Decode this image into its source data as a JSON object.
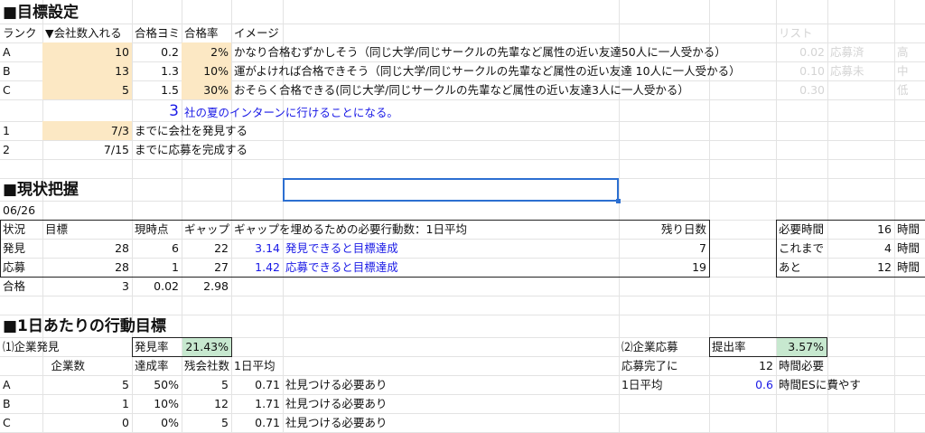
{
  "s1": {
    "title": "■目標設定",
    "headers": {
      "rank": "ランク",
      "companies": "▼会社数入れる",
      "pass_est": "合格ヨミ",
      "pass_rate": "合格率",
      "image": "イメージ",
      "list": "リスト"
    },
    "rows": [
      {
        "rank": "A",
        "companies": "10",
        "pass_est": "0.2",
        "pass_rate": "2%",
        "image": "かなり合格むずかしそう（同じ大学/同じサークルの先輩など属性の近い友達50人に一人受かる）",
        "list_val": "0.02",
        "list_status": "応募済",
        "list_level": "高"
      },
      {
        "rank": "B",
        "companies": "13",
        "pass_est": "1.3",
        "pass_rate": "10%",
        "image": "運がよければ合格できそう（同じ大学/同じサークルの先輩など属性の近い友達 10人に一人受かる）",
        "list_val": "0.10",
        "list_status": "応募未",
        "list_level": "中"
      },
      {
        "rank": "C",
        "companies": "5",
        "pass_est": "1.5",
        "pass_rate": "30%",
        "image": "おそらく合格できる(同じ大学/同じサークルの先輩など属性の近い友達3人に一人受かる）",
        "list_val": "0.30",
        "list_status": "",
        "list_level": "低"
      }
    ],
    "summary_num": "3",
    "summary_text": "社の夏のインターンに行けることになる。",
    "deadlines": [
      {
        "num": "1",
        "date": "7/3",
        "text": "までに会社を発見する"
      },
      {
        "num": "2",
        "date": "7/15",
        "text": "までに応募を完成する"
      }
    ]
  },
  "s2": {
    "title": "■現状把握",
    "date": "06/26",
    "headers": {
      "status": "状況",
      "target": "目標",
      "current": "現時点",
      "gap": "ギャップ",
      "action": "ギャップを埋めるための必要行動数：1日平均",
      "days_left": "残り日数"
    },
    "rows": [
      {
        "status": "発見",
        "target": "28",
        "current": "6",
        "gap": "22",
        "daily": "3.14",
        "note": "発見できると目標達成",
        "days": "7"
      },
      {
        "status": "応募",
        "target": "28",
        "current": "1",
        "gap": "27",
        "daily": "1.42",
        "note": "応募できると目標達成",
        "days": "19"
      },
      {
        "status": "合格",
        "target": "3",
        "current": "0.02",
        "gap": "2.98",
        "daily": "",
        "note": "",
        "days": ""
      }
    ],
    "time_box": [
      {
        "label": "必要時間",
        "value": "16",
        "unit": "時間"
      },
      {
        "label": "これまで",
        "value": "4",
        "unit": "時間"
      },
      {
        "label": "あと",
        "value": "12",
        "unit": "時間"
      }
    ]
  },
  "s3": {
    "title": "■1日あたりの行動目標",
    "left_title": "⑴企業発見",
    "discovery_rate_label": "発見率",
    "discovery_rate": "21.43%",
    "headers": {
      "count": "企業数",
      "achieve": "達成率",
      "remaining": "残会社数",
      "daily": "1日平均"
    },
    "rows": [
      {
        "rank": "A",
        "count": "5",
        "achieve": "50%",
        "remaining": "5",
        "daily": "0.71",
        "note": "社見つける必要あり"
      },
      {
        "rank": "B",
        "count": "1",
        "achieve": "10%",
        "remaining": "12",
        "daily": "1.71",
        "note": "社見つける必要あり"
      },
      {
        "rank": "C",
        "count": "0",
        "achieve": "0%",
        "remaining": "5",
        "daily": "0.71",
        "note": "社見つける必要あり"
      }
    ],
    "right_title": "⑵企業応募",
    "submit_rate_label": "提出率",
    "submit_rate": "3.57%",
    "complete_label": "応募完了に",
    "complete_value": "12",
    "complete_unit": "時間必要",
    "daily_label": "1日平均",
    "daily_value": "0.6",
    "daily_unit": "時間ESに費やす"
  }
}
